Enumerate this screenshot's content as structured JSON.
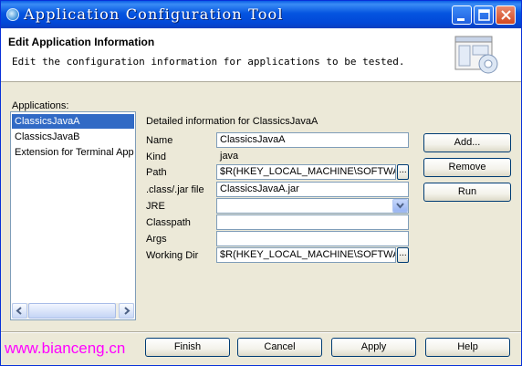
{
  "window": {
    "title": "Application Configuration Tool"
  },
  "header": {
    "title": "Edit Application Information",
    "description": "Edit the configuration information for applications to be tested."
  },
  "applications": {
    "label": "Applications:",
    "items": [
      {
        "label": "ClassicsJavaA",
        "selected": true
      },
      {
        "label": "ClassicsJavaB",
        "selected": false
      },
      {
        "label": "Extension for Terminal Applic",
        "selected": false
      }
    ]
  },
  "details": {
    "title": "Detailed information for ClassicsJavaA",
    "fields": {
      "name": {
        "label": "Name",
        "value": "ClassicsJavaA"
      },
      "kind": {
        "label": "Kind",
        "value": "java"
      },
      "path": {
        "label": "Path",
        "value": "$R(HKEY_LOCAL_MACHINE\\SOFTWARE\\"
      },
      "class_jar": {
        "label": ".class/.jar file",
        "value": "ClassicsJavaA.jar"
      },
      "jre": {
        "label": "JRE",
        "value": ""
      },
      "classpath": {
        "label": "Classpath",
        "value": ""
      },
      "args": {
        "label": "Args",
        "value": ""
      },
      "working_dir": {
        "label": "Working Dir",
        "value": "$R(HKEY_LOCAL_MACHINE\\SOFTWARE\\"
      }
    },
    "ellipsis": "..."
  },
  "side_buttons": {
    "add": "Add...",
    "remove": "Remove",
    "run": "Run"
  },
  "bottom_buttons": {
    "finish": "Finish",
    "cancel": "Cancel",
    "apply": "Apply",
    "help": "Help"
  },
  "watermark": "www.bianceng.cn",
  "colors": {
    "title_bar": "#0555e0",
    "selection": "#316ac5",
    "watermark": "#ff00ff",
    "dialog_bg": "#ece9d8"
  },
  "icons": [
    "app-icon",
    "minimize-icon",
    "maximize-icon",
    "close-icon",
    "wizard-graphic-icon",
    "scroll-left-icon",
    "scroll-right-icon",
    "dropdown-arrow-icon"
  ]
}
